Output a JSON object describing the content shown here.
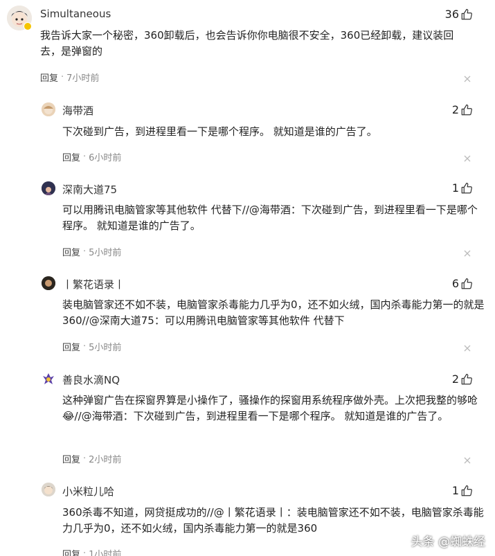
{
  "comments": [
    {
      "name": "Simultaneous",
      "likes": "36",
      "text": "我告诉大家一个秘密，360卸载后，也会告诉你你电脑很不安全，360已经卸载，建议装回去，是弹窗的",
      "reply_label": "回复",
      "time": "7小时前"
    },
    {
      "name": "海带酒",
      "likes": "2",
      "text": "下次碰到广告，到进程里看一下是哪个程序。 就知道是谁的广告了。",
      "reply_label": "回复",
      "time": "6小时前"
    },
    {
      "name": "深南大道75",
      "likes": "1",
      "text": "可以用腾讯电脑管家等其他软件 代替下//@海带酒：下次碰到广告，到进程里看一下是哪个程序。 就知道是谁的广告了。",
      "reply_label": "回复",
      "time": "5小时前"
    },
    {
      "name": "丨繁花语录丨",
      "likes": "6",
      "text": "装电脑管家还不如不装，电脑管家杀毒能力几乎为0，还不如火绒，国内杀毒能力第一的就是360//@深南大道75：可以用腾讯电脑管家等其他软件 代替下",
      "reply_label": "回复",
      "time": "5小时前"
    },
    {
      "name": "善良水滴NQ",
      "likes": "2",
      "text": "这种弹窗广告在探窗界算是小操作了，骚操作的探窗用系统程序做外壳。上次把我整的够呛😂//@海带酒：下次碰到广告，到进程里看一下是哪个程序。 就知道是谁的广告了。",
      "reply_label": "回复",
      "time": "2小时前"
    },
    {
      "name": "小米粒儿哈",
      "likes": "1",
      "text": "360杀毒不知道，网贷挺成功的//@丨繁花语录丨：装电脑管家还不如不装，电脑管家杀毒能力几乎为0，还不如火绒，国内杀毒能力第一的就是360",
      "reply_label": "回复",
      "time": "1小时前"
    }
  ],
  "watermark": "头条 @蜘蛛经",
  "colors": {
    "text": "#222222",
    "muted": "#888888",
    "accent_badge": "#f5c400"
  },
  "icons": {
    "like": "thumbs-up-icon",
    "close": "close-icon",
    "verified": "verified-badge-icon"
  }
}
